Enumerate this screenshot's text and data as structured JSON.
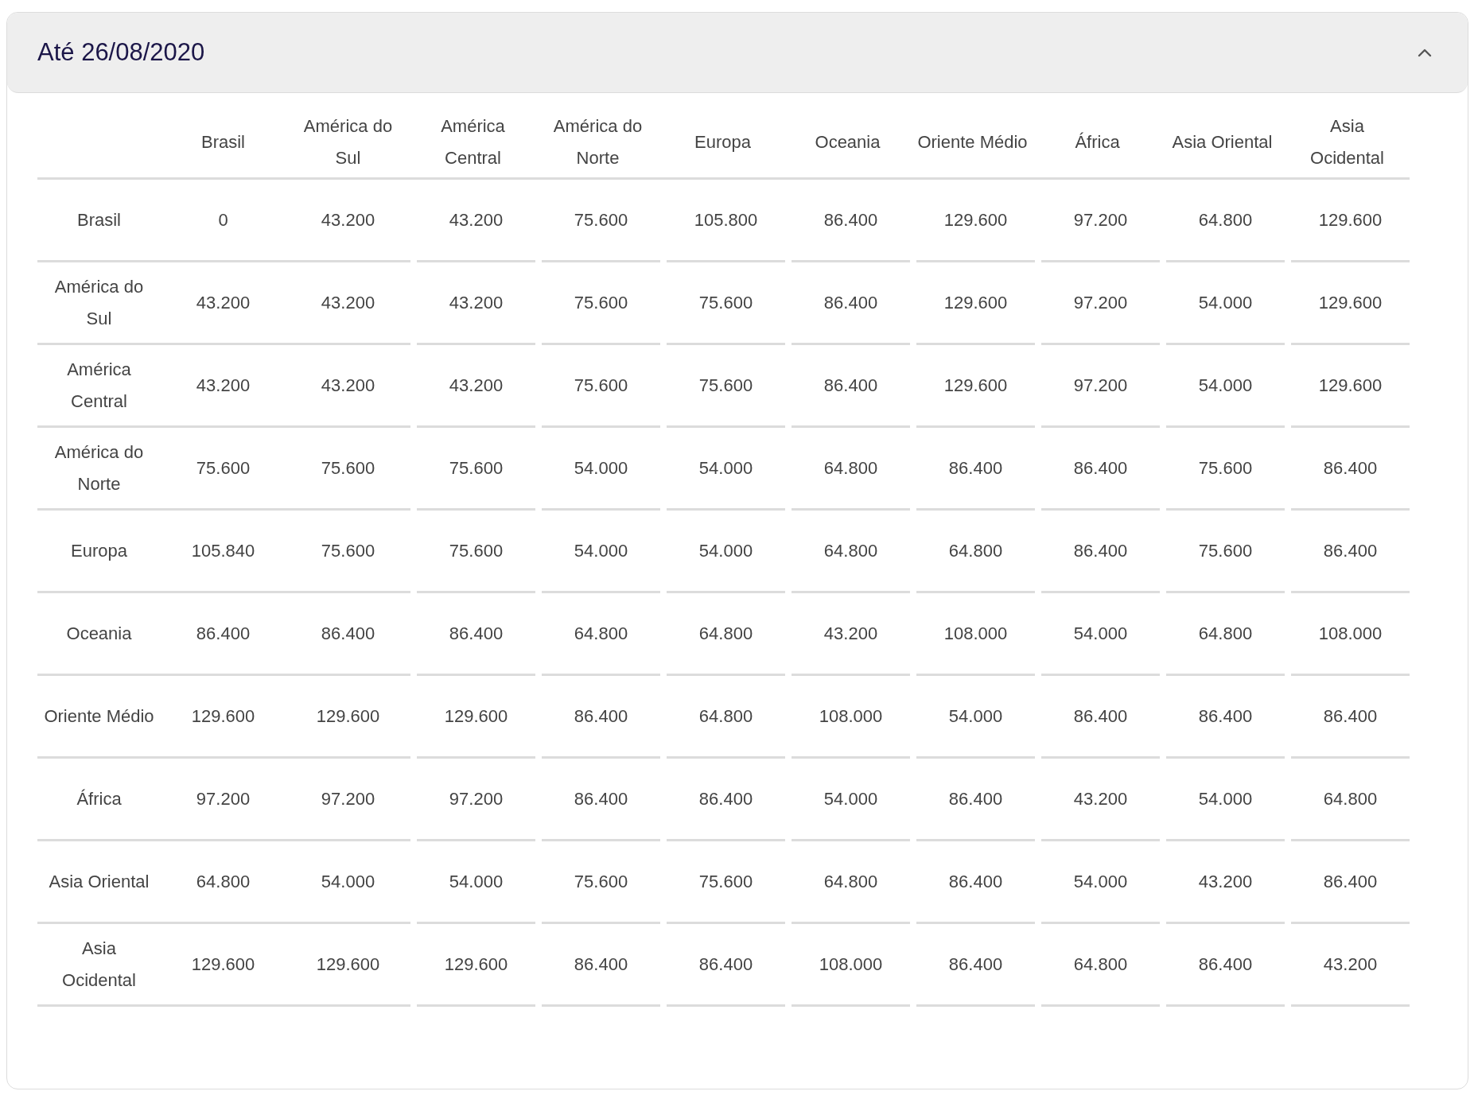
{
  "panel": {
    "title": "Até 26/08/2020",
    "expanded": true
  },
  "table": {
    "columns": [
      "Brasil",
      "América do Sul",
      "América Central",
      "América do Norte",
      "Europa",
      "Oceania",
      "Oriente Médio",
      "África",
      "Asia Oriental",
      "Asia Ocidental"
    ],
    "rows": [
      {
        "label": "Brasil",
        "values": [
          "0",
          "43.200",
          "43.200",
          "75.600",
          "105.800",
          "86.400",
          "129.600",
          "97.200",
          "64.800",
          "129.600"
        ]
      },
      {
        "label": "América do Sul",
        "values": [
          "43.200",
          "43.200",
          "43.200",
          "75.600",
          "75.600",
          "86.400",
          "129.600",
          "97.200",
          "54.000",
          "129.600"
        ]
      },
      {
        "label": "América Central",
        "values": [
          "43.200",
          "43.200",
          "43.200",
          "75.600",
          "75.600",
          "86.400",
          "129.600",
          "97.200",
          "54.000",
          "129.600"
        ]
      },
      {
        "label": "América do Norte",
        "values": [
          "75.600",
          "75.600",
          "75.600",
          "54.000",
          "54.000",
          "64.800",
          "86.400",
          "86.400",
          "75.600",
          "86.400"
        ]
      },
      {
        "label": "Europa",
        "values": [
          "105.840",
          "75.600",
          "75.600",
          "54.000",
          "54.000",
          "64.800",
          "64.800",
          "86.400",
          "75.600",
          "86.400"
        ]
      },
      {
        "label": "Oceania",
        "values": [
          "86.400",
          "86.400",
          "86.400",
          "64.800",
          "64.800",
          "43.200",
          "108.000",
          "54.000",
          "64.800",
          "108.000"
        ]
      },
      {
        "label": "Oriente Médio",
        "values": [
          "129.600",
          "129.600",
          "129.600",
          "86.400",
          "64.800",
          "108.000",
          "54.000",
          "86.400",
          "86.400",
          "86.400"
        ]
      },
      {
        "label": "África",
        "values": [
          "97.200",
          "97.200",
          "97.200",
          "86.400",
          "86.400",
          "54.000",
          "86.400",
          "43.200",
          "54.000",
          "64.800"
        ]
      },
      {
        "label": "Asia Oriental",
        "values": [
          "64.800",
          "54.000",
          "54.000",
          "75.600",
          "75.600",
          "64.800",
          "86.400",
          "54.000",
          "43.200",
          "86.400"
        ]
      },
      {
        "label": "Asia Ocidental",
        "values": [
          "129.600",
          "129.600",
          "129.600",
          "86.400",
          "86.400",
          "108.000",
          "86.400",
          "64.800",
          "86.400",
          "43.200"
        ]
      }
    ]
  }
}
